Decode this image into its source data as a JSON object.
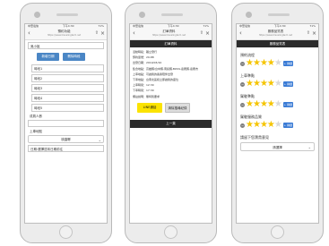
{
  "status": {
    "carrier": "中華電信",
    "time": "下午4:30",
    "battery": "71%"
  },
  "phone1": {
    "title": "預約功能",
    "url": "https://www.travelingtech.net",
    "name_value": "吳小姐",
    "buttons": [
      "新增日期",
      "刪除時段"
    ],
    "options": [
      "時段1",
      "時段2",
      "時段3",
      "時段4",
      "時段5"
    ],
    "label_people": "成員人數",
    "label_area": "上車地點",
    "select_value": "桃園縣",
    "note": "日期:選擇週末日期前往"
  },
  "phone2": {
    "title": "訂單資料",
    "url": "https://www.travelingtech.net",
    "header": "訂單資料",
    "lines": [
      "活動時段：獨立發行",
      "預約單號：29-88",
      "出發日期：2019/03/10",
      "集合地點：高雄縣/台中縣,南投縣,BOSS,嘉義縣,嘉義市",
      "上車地點：可讓我的長輩陪伴出發",
      "下車地點：台南北區和立即讓我的座位",
      "上車時間：12:30",
      "下車時間：17:30",
      "備註說明：無特別要求"
    ],
    "line_button": "LINE通話",
    "gray_button": "清除搜尋紀錄",
    "footer": "上一頁"
  },
  "phone3": {
    "title": "服務品質表",
    "url": "https://www.travelingtech.net",
    "header": "服務品質表",
    "ratings": [
      {
        "label": "預約流程",
        "stars": 4
      },
      {
        "label": "上車準點",
        "stars": 4
      },
      {
        "label": "駕駛準點",
        "stars": 4
      },
      {
        "label": "駕駛服務品質",
        "stars": 4
      }
    ],
    "plus_label": "+ 稱讚",
    "question": "請留下您寶貴意見",
    "select_value": "請選擇"
  },
  "icons": {
    "back": "chevron-left-icon",
    "share": "share-icon",
    "close": "close-icon",
    "minus": "minus-icon",
    "star": "star-icon",
    "chevron": "chevron-down-icon"
  },
  "colors": {
    "blue_button": "#4a86c5",
    "line_yellow": "#fbe300",
    "dark_bar": "#2b2b2b",
    "star_on": "#f5c400",
    "star_off": "#d9d9d9"
  }
}
